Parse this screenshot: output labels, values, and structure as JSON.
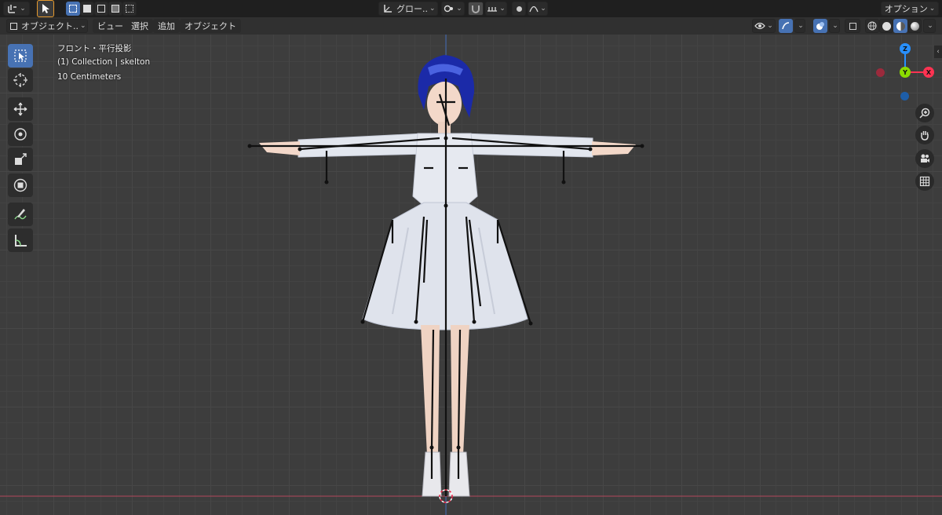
{
  "top": {
    "transform_orientation": "グロー..",
    "options_label": "オプション"
  },
  "header": {
    "mode_label": "オブジェクト..",
    "menus": [
      "ビュー",
      "選択",
      "追加",
      "オブジェクト"
    ]
  },
  "viewport": {
    "view_name": "フロント・平行投影",
    "collection_info": "(1) Collection | skelton",
    "grid_scale": "10 Centimeters"
  },
  "gizmo": {
    "z_label": "Z",
    "y_label": "Y",
    "x_label": "X"
  },
  "colors": {
    "accent": "#4772b3",
    "axis_x": "#ff3352",
    "axis_y": "#8bdc00",
    "axis_z": "#2890ff"
  }
}
